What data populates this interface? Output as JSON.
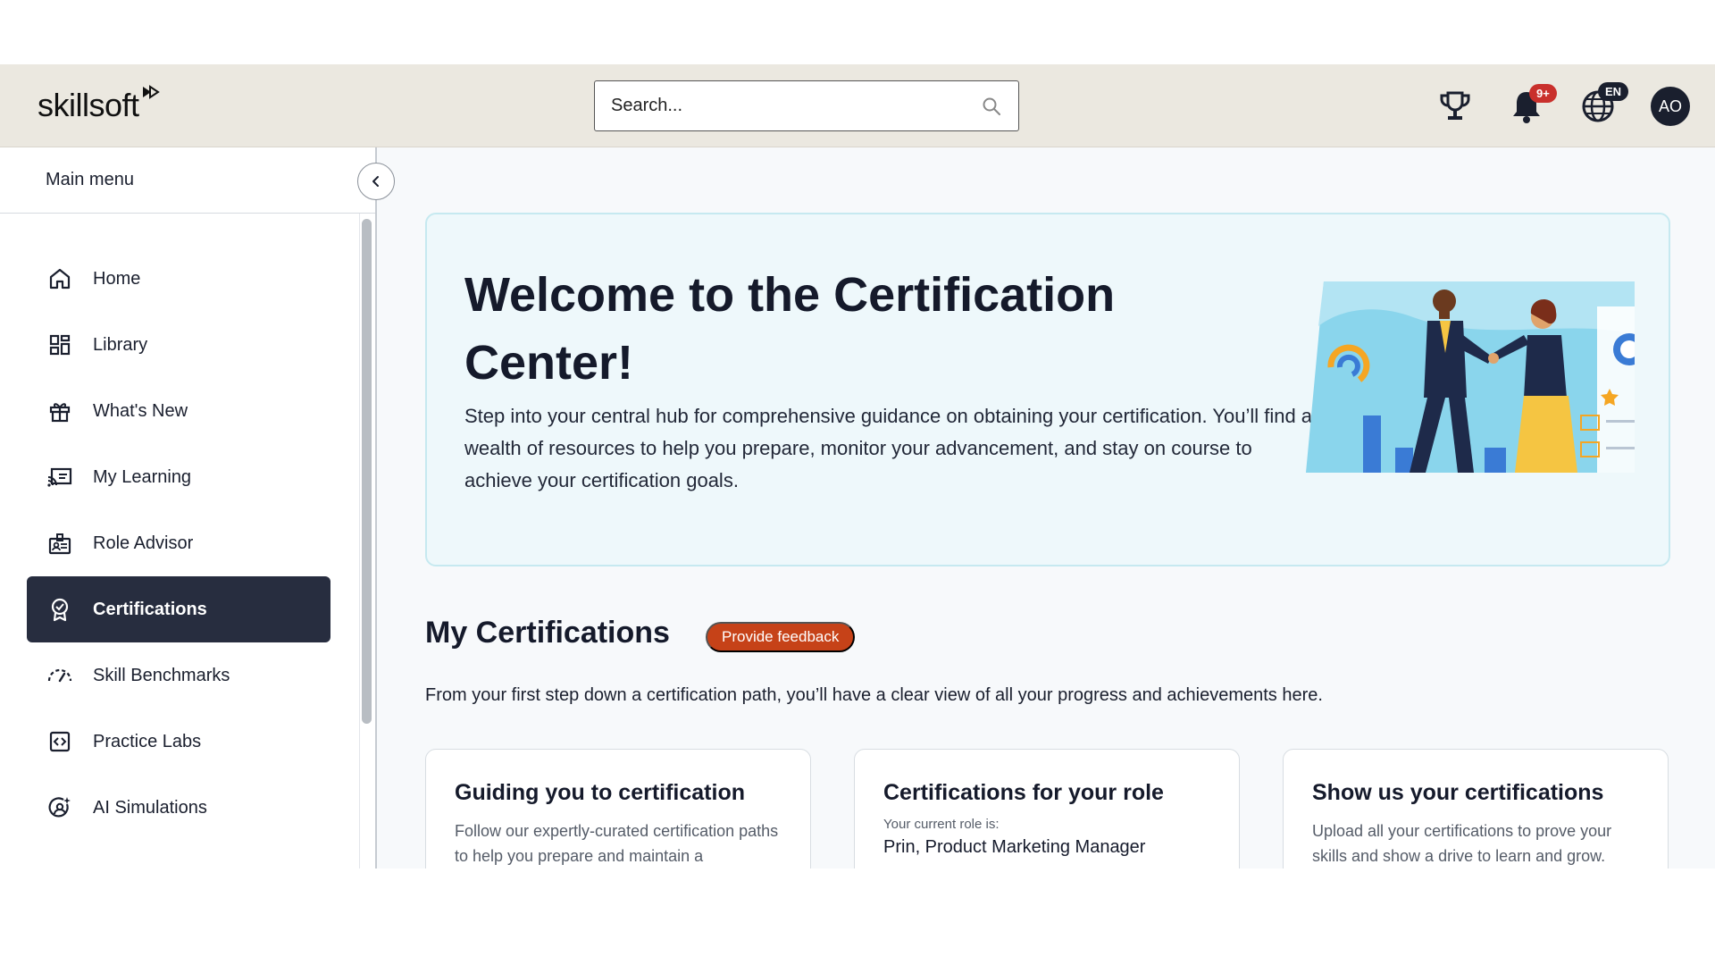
{
  "header": {
    "logo_text": "skillsoft",
    "search_placeholder": "Search...",
    "notifications_badge": "9+",
    "language": "EN",
    "avatar_initials": "AO"
  },
  "sidebar": {
    "title": "Main menu",
    "items": [
      {
        "label": "Home",
        "icon": "home-icon"
      },
      {
        "label": "Library",
        "icon": "library-icon"
      },
      {
        "label": "What's New",
        "icon": "gift-icon"
      },
      {
        "label": "My Learning",
        "icon": "my-learning-icon"
      },
      {
        "label": "Role Advisor",
        "icon": "role-advisor-icon"
      },
      {
        "label": "Certifications",
        "icon": "certification-icon",
        "active": true
      },
      {
        "label": "Skill Benchmarks",
        "icon": "gauge-icon"
      },
      {
        "label": "Practice Labs",
        "icon": "code-icon"
      },
      {
        "label": "AI Simulations",
        "icon": "ai-simulation-icon"
      }
    ]
  },
  "hero": {
    "title": "Welcome to the Certification Center!",
    "description": "Step into your central hub for comprehensive guidance on obtaining your certification. You’ll find a wealth of resources to help you prepare, monitor your advancement, and stay on course to achieve your certification goals."
  },
  "my_certifications": {
    "title": "My Certifications",
    "feedback_label": "Provide feedback",
    "description": "From your first step down a certification path, you’ll have a clear view of all your progress and achievements here."
  },
  "cards": [
    {
      "title": "Guiding you to certification",
      "text": "Follow our expertly-curated certification paths to help you prepare and maintain a"
    },
    {
      "title": "Certifications for your role",
      "label": "Your current role is:",
      "role": "Prin, Product Marketing Manager"
    },
    {
      "title": "Show us your certifications",
      "text": "Upload all your certifications to prove your skills and show a drive to learn and grow."
    }
  ],
  "colors": {
    "header_bg": "#ebe8e0",
    "active_nav": "#272d3f",
    "feedback_button": "#c64218",
    "badge": "#c9302c",
    "hero_bg": "#eef8fb"
  }
}
